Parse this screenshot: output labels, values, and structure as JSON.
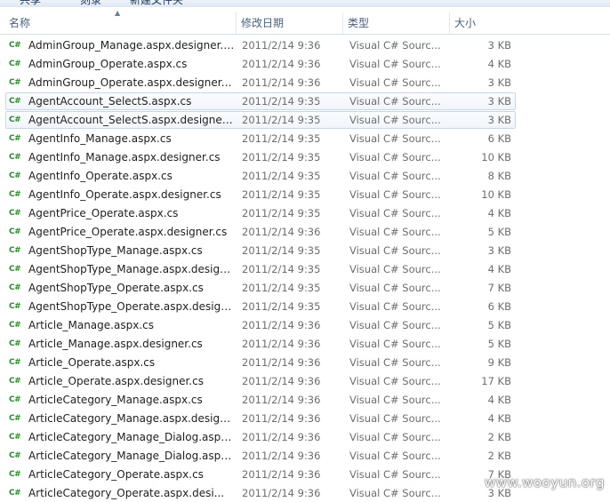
{
  "toolbar": {
    "items": [
      "共享",
      "刻录",
      "新建文件夹"
    ]
  },
  "columns": {
    "name": "名称",
    "date": "修改日期",
    "type": "类型",
    "size": "大小"
  },
  "colors": {
    "cs_icon": "#2b8a2b",
    "selection_border": "#c8d7e8",
    "header_text": "#4c607a"
  },
  "icon": "csharp-file-icon",
  "files": [
    {
      "name": "AdminGroup_Manage.aspx.designer.cs",
      "date": "2011/2/14 9:36",
      "type": "Visual C# Sourc...",
      "size": "3 KB",
      "selected": false
    },
    {
      "name": "AdminGroup_Operate.aspx.cs",
      "date": "2011/2/14 9:36",
      "type": "Visual C# Sourc...",
      "size": "4 KB",
      "selected": false
    },
    {
      "name": "AdminGroup_Operate.aspx.designer.cs",
      "date": "2011/2/14 9:36",
      "type": "Visual C# Sourc...",
      "size": "3 KB",
      "selected": false
    },
    {
      "name": "AgentAccount_SelectS.aspx.cs",
      "date": "2011/2/14 9:35",
      "type": "Visual C# Sourc...",
      "size": "3 KB",
      "selected": true
    },
    {
      "name": "AgentAccount_SelectS.aspx.designer.cs",
      "date": "2011/2/14 9:35",
      "type": "Visual C# Sourc...",
      "size": "3 KB",
      "selected": true
    },
    {
      "name": "AgentInfo_Manage.aspx.cs",
      "date": "2011/2/14 9:35",
      "type": "Visual C# Sourc...",
      "size": "6 KB",
      "selected": false
    },
    {
      "name": "AgentInfo_Manage.aspx.designer.cs",
      "date": "2011/2/14 9:35",
      "type": "Visual C# Sourc...",
      "size": "10 KB",
      "selected": false
    },
    {
      "name": "AgentInfo_Operate.aspx.cs",
      "date": "2011/2/14 9:35",
      "type": "Visual C# Sourc...",
      "size": "8 KB",
      "selected": false
    },
    {
      "name": "AgentInfo_Operate.aspx.designer.cs",
      "date": "2011/2/14 9:35",
      "type": "Visual C# Sourc...",
      "size": "10 KB",
      "selected": false
    },
    {
      "name": "AgentPrice_Operate.aspx.cs",
      "date": "2011/2/14 9:35",
      "type": "Visual C# Sourc...",
      "size": "4 KB",
      "selected": false
    },
    {
      "name": "AgentPrice_Operate.aspx.designer.cs",
      "date": "2011/2/14 9:36",
      "type": "Visual C# Sourc...",
      "size": "5 KB",
      "selected": false
    },
    {
      "name": "AgentShopType_Manage.aspx.cs",
      "date": "2011/2/14 9:35",
      "type": "Visual C# Sourc...",
      "size": "3 KB",
      "selected": false
    },
    {
      "name": "AgentShopType_Manage.aspx.design...",
      "date": "2011/2/14 9:35",
      "type": "Visual C# Sourc...",
      "size": "4 KB",
      "selected": false
    },
    {
      "name": "AgentShopType_Operate.aspx.cs",
      "date": "2011/2/14 9:35",
      "type": "Visual C# Sourc...",
      "size": "7 KB",
      "selected": false
    },
    {
      "name": "AgentShopType_Operate.aspx.design...",
      "date": "2011/2/14 9:35",
      "type": "Visual C# Sourc...",
      "size": "6 KB",
      "selected": false
    },
    {
      "name": "Article_Manage.aspx.cs",
      "date": "2011/2/14 9:36",
      "type": "Visual C# Sourc...",
      "size": "5 KB",
      "selected": false
    },
    {
      "name": "Article_Manage.aspx.designer.cs",
      "date": "2011/2/14 9:36",
      "type": "Visual C# Sourc...",
      "size": "5 KB",
      "selected": false
    },
    {
      "name": "Article_Operate.aspx.cs",
      "date": "2011/2/14 9:36",
      "type": "Visual C# Sourc...",
      "size": "9 KB",
      "selected": false
    },
    {
      "name": "Article_Operate.aspx.designer.cs",
      "date": "2011/2/14 9:36",
      "type": "Visual C# Sourc...",
      "size": "17 KB",
      "selected": false
    },
    {
      "name": "ArticleCategory_Manage.aspx.cs",
      "date": "2011/2/14 9:36",
      "type": "Visual C# Sourc...",
      "size": "4 KB",
      "selected": false
    },
    {
      "name": "ArticleCategory_Manage.aspx.design...",
      "date": "2011/2/14 9:36",
      "type": "Visual C# Sourc...",
      "size": "4 KB",
      "selected": false
    },
    {
      "name": "ArticleCategory_Manage_Dialog.aspx...",
      "date": "2011/2/14 9:36",
      "type": "Visual C# Sourc...",
      "size": "2 KB",
      "selected": false
    },
    {
      "name": "ArticleCategory_Manage_Dialog.aspx...",
      "date": "2011/2/14 9:36",
      "type": "Visual C# Sourc...",
      "size": "2 KB",
      "selected": false
    },
    {
      "name": "ArticleCategory_Operate.aspx.cs",
      "date": "2011/2/14 9:36",
      "type": "Visual C# Sourc...",
      "size": "7 KB",
      "selected": false
    },
    {
      "name": "ArticleCategory_Operate.aspx.desi...",
      "date": "2011/2/14 9:36",
      "type": "Visual C# Sourc...",
      "size": "3 KB",
      "selected": false
    }
  ],
  "watermark": "www.wooyun.org"
}
